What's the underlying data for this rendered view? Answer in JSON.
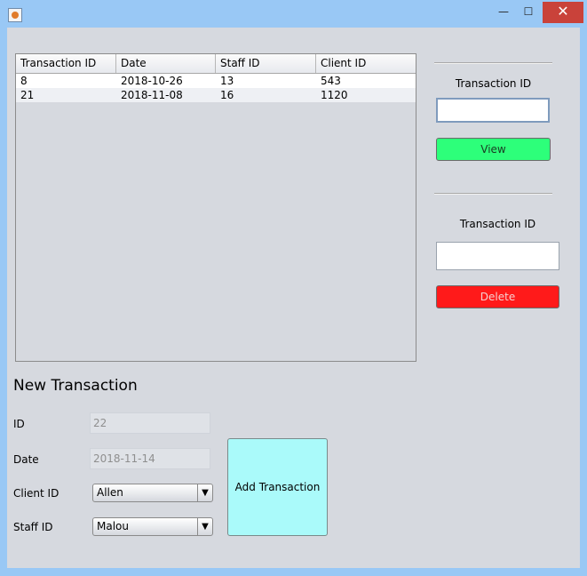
{
  "window": {
    "icon": "java-cup-icon",
    "controls": {
      "minimize": "—",
      "maximize": "☐",
      "close": "✕"
    }
  },
  "transactions_table": {
    "columns": [
      "Transaction ID",
      "Date",
      "Staff ID",
      "Client ID"
    ],
    "rows": [
      [
        "8",
        "2018-10-26",
        "13",
        "543"
      ],
      [
        "21",
        "2018-11-08",
        "16",
        "1120"
      ]
    ]
  },
  "view_panel": {
    "label": "Transaction ID",
    "value": "",
    "button_label": "View",
    "button_color": "#2dff7a"
  },
  "delete_panel": {
    "label": "Transaction ID",
    "value": "",
    "button_label": "Delete",
    "button_color": "#ff1a1a"
  },
  "new_transaction": {
    "title": "New Transaction",
    "id_label": "ID",
    "id_value": "22",
    "date_label": "Date",
    "date_value": "2018-11-14",
    "client_label": "Client ID",
    "client_value": "Allen",
    "staff_label": "Staff ID",
    "staff_value": "Malou",
    "add_button_label": "Add Transaction",
    "add_button_color": "#aafafa"
  }
}
